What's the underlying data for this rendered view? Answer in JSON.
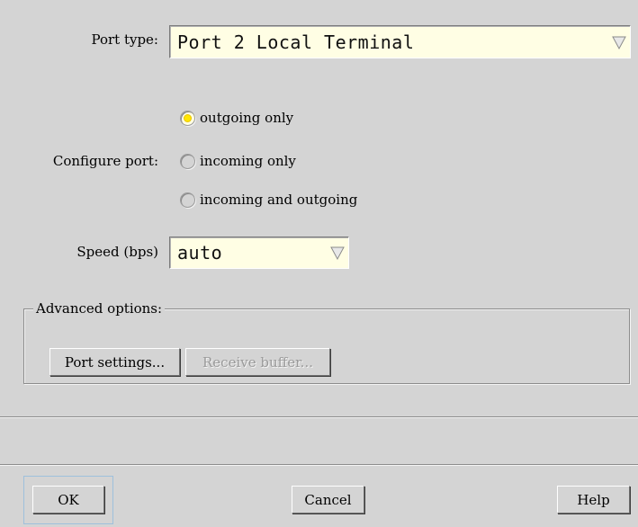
{
  "port_type": {
    "label": "Port type:",
    "value": "Port 2 Local Terminal",
    "arrow_icon": "triangle-down-icon"
  },
  "configure_port": {
    "label": "Configure port:",
    "options": [
      {
        "label": "outgoing only",
        "selected": true
      },
      {
        "label": "incoming only",
        "selected": false
      },
      {
        "label": "incoming and outgoing",
        "selected": false
      }
    ]
  },
  "speed": {
    "label": "Speed (bps)",
    "value": "auto",
    "arrow_icon": "triangle-down-icon"
  },
  "advanced": {
    "legend": "Advanced options:",
    "port_settings_label": "Port settings...",
    "receive_buffer_label": "Receive buffer..."
  },
  "footer": {
    "ok_label": "OK",
    "cancel_label": "Cancel",
    "help_label": "Help"
  },
  "colors": {
    "background": "#d4d4d4",
    "field_background": "#fffee4",
    "radio_selected": "#ffe600",
    "focus_ring": "#9ec0dc"
  }
}
